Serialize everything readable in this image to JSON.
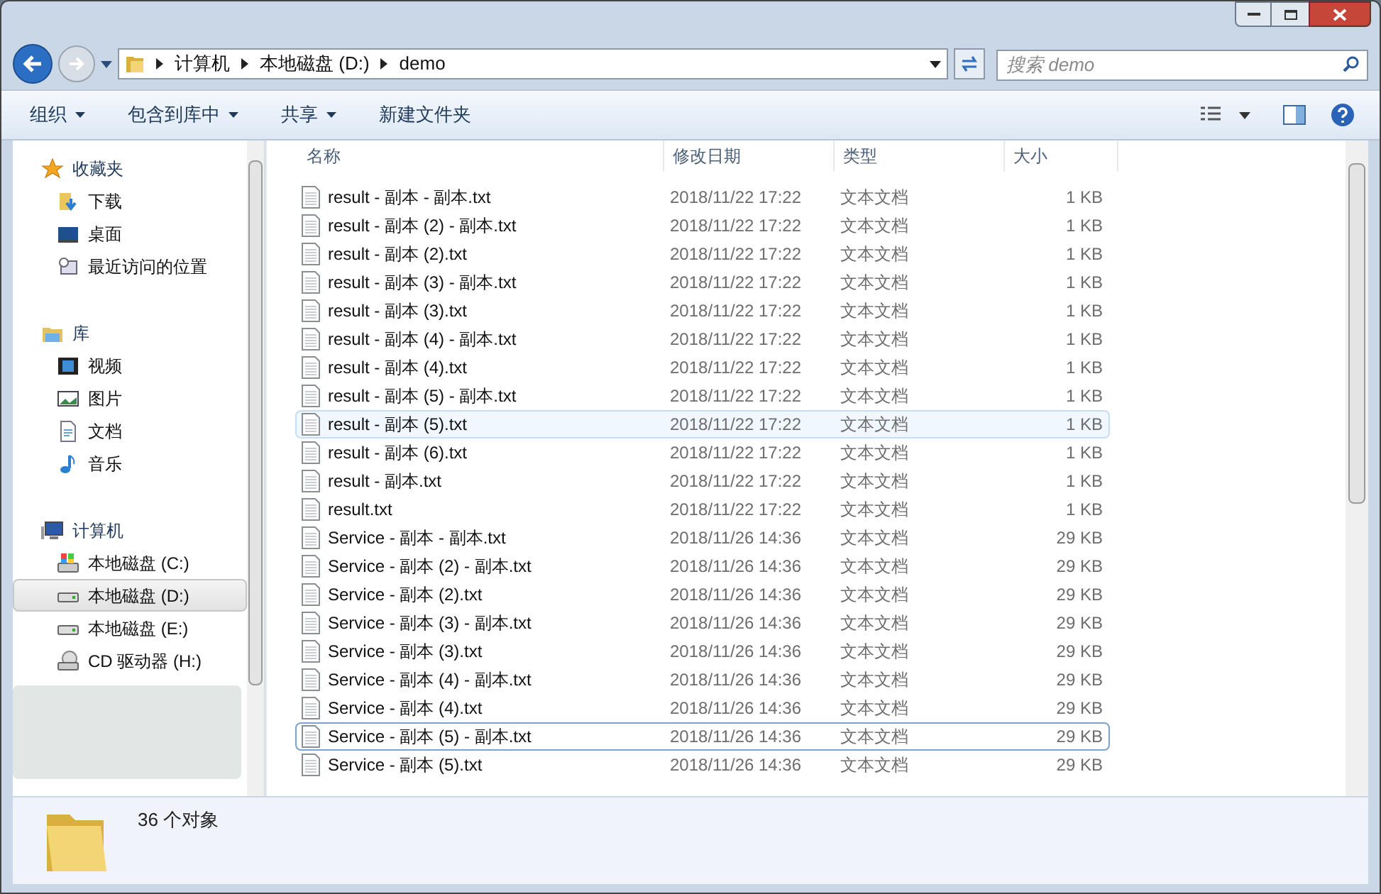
{
  "address_bar": {
    "crumbs": [
      "计算机",
      "本地磁盘 (D:)",
      "demo"
    ]
  },
  "search": {
    "placeholder": "搜索 demo"
  },
  "toolbar": {
    "buttons": [
      {
        "label": "组织",
        "dropdown": true
      },
      {
        "label": "包含到库中",
        "dropdown": true
      },
      {
        "label": "共享",
        "dropdown": true
      },
      {
        "label": "新建文件夹",
        "dropdown": false
      }
    ]
  },
  "sidebar": {
    "groups": [
      {
        "label": "收藏夹",
        "kind": "favorites",
        "items": [
          {
            "label": "下载",
            "kind": "download",
            "selected": false
          },
          {
            "label": "桌面",
            "kind": "desktop",
            "selected": false
          },
          {
            "label": "最近访问的位置",
            "kind": "recent",
            "selected": false
          }
        ]
      },
      {
        "label": "库",
        "kind": "library",
        "items": [
          {
            "label": "视频",
            "kind": "video",
            "selected": false
          },
          {
            "label": "图片",
            "kind": "picture",
            "selected": false
          },
          {
            "label": "文档",
            "kind": "document",
            "selected": false
          },
          {
            "label": "音乐",
            "kind": "music",
            "selected": false
          }
        ]
      },
      {
        "label": "计算机",
        "kind": "computer",
        "items": [
          {
            "label": "本地磁盘 (C:)",
            "kind": "sysdrive",
            "selected": false
          },
          {
            "label": "本地磁盘 (D:)",
            "kind": "drive",
            "selected": true
          },
          {
            "label": "本地磁盘 (E:)",
            "kind": "drive",
            "selected": false
          },
          {
            "label": "CD 驱动器 (H:)",
            "kind": "cd",
            "selected": false
          }
        ]
      }
    ]
  },
  "table": {
    "columns": [
      "名称",
      "修改日期",
      "类型",
      "大小"
    ],
    "rows": [
      {
        "name": "result - 副本 - 副本.txt",
        "date": "2018/11/22 17:22",
        "type": "文本文档",
        "size": "1 KB",
        "highlighted": false,
        "focused": false
      },
      {
        "name": "result - 副本 (2) - 副本.txt",
        "date": "2018/11/22 17:22",
        "type": "文本文档",
        "size": "1 KB",
        "highlighted": false,
        "focused": false
      },
      {
        "name": "result - 副本 (2).txt",
        "date": "2018/11/22 17:22",
        "type": "文本文档",
        "size": "1 KB",
        "highlighted": false,
        "focused": false
      },
      {
        "name": "result - 副本 (3) - 副本.txt",
        "date": "2018/11/22 17:22",
        "type": "文本文档",
        "size": "1 KB",
        "highlighted": false,
        "focused": false
      },
      {
        "name": "result - 副本 (3).txt",
        "date": "2018/11/22 17:22",
        "type": "文本文档",
        "size": "1 KB",
        "highlighted": false,
        "focused": false
      },
      {
        "name": "result - 副本 (4) - 副本.txt",
        "date": "2018/11/22 17:22",
        "type": "文本文档",
        "size": "1 KB",
        "highlighted": false,
        "focused": false
      },
      {
        "name": "result - 副本 (4).txt",
        "date": "2018/11/22 17:22",
        "type": "文本文档",
        "size": "1 KB",
        "highlighted": false,
        "focused": false
      },
      {
        "name": "result - 副本 (5) - 副本.txt",
        "date": "2018/11/22 17:22",
        "type": "文本文档",
        "size": "1 KB",
        "highlighted": false,
        "focused": false
      },
      {
        "name": "result - 副本 (5).txt",
        "date": "2018/11/22 17:22",
        "type": "文本文档",
        "size": "1 KB",
        "highlighted": true,
        "focused": false
      },
      {
        "name": "result - 副本 (6).txt",
        "date": "2018/11/22 17:22",
        "type": "文本文档",
        "size": "1 KB",
        "highlighted": false,
        "focused": false
      },
      {
        "name": "result - 副本.txt",
        "date": "2018/11/22 17:22",
        "type": "文本文档",
        "size": "1 KB",
        "highlighted": false,
        "focused": false
      },
      {
        "name": "result.txt",
        "date": "2018/11/22 17:22",
        "type": "文本文档",
        "size": "1 KB",
        "highlighted": false,
        "focused": false
      },
      {
        "name": "Service - 副本 - 副本.txt",
        "date": "2018/11/26 14:36",
        "type": "文本文档",
        "size": "29 KB",
        "highlighted": false,
        "focused": false
      },
      {
        "name": "Service - 副本 (2) - 副本.txt",
        "date": "2018/11/26 14:36",
        "type": "文本文档",
        "size": "29 KB",
        "highlighted": false,
        "focused": false
      },
      {
        "name": "Service - 副本 (2).txt",
        "date": "2018/11/26 14:36",
        "type": "文本文档",
        "size": "29 KB",
        "highlighted": false,
        "focused": false
      },
      {
        "name": "Service - 副本 (3) - 副本.txt",
        "date": "2018/11/26 14:36",
        "type": "文本文档",
        "size": "29 KB",
        "highlighted": false,
        "focused": false
      },
      {
        "name": "Service - 副本 (3).txt",
        "date": "2018/11/26 14:36",
        "type": "文本文档",
        "size": "29 KB",
        "highlighted": false,
        "focused": false
      },
      {
        "name": "Service - 副本 (4) - 副本.txt",
        "date": "2018/11/26 14:36",
        "type": "文本文档",
        "size": "29 KB",
        "highlighted": false,
        "focused": false
      },
      {
        "name": "Service - 副本 (4).txt",
        "date": "2018/11/26 14:36",
        "type": "文本文档",
        "size": "29 KB",
        "highlighted": false,
        "focused": false
      },
      {
        "name": "Service - 副本 (5) - 副本.txt",
        "date": "2018/11/26 14:36",
        "type": "文本文档",
        "size": "29 KB",
        "highlighted": false,
        "focused": true
      },
      {
        "name": "Service - 副本 (5).txt",
        "date": "2018/11/26 14:36",
        "type": "文本文档",
        "size": "29 KB",
        "highlighted": false,
        "focused": false
      }
    ]
  },
  "status_bar": {
    "count": "36 个对象"
  }
}
